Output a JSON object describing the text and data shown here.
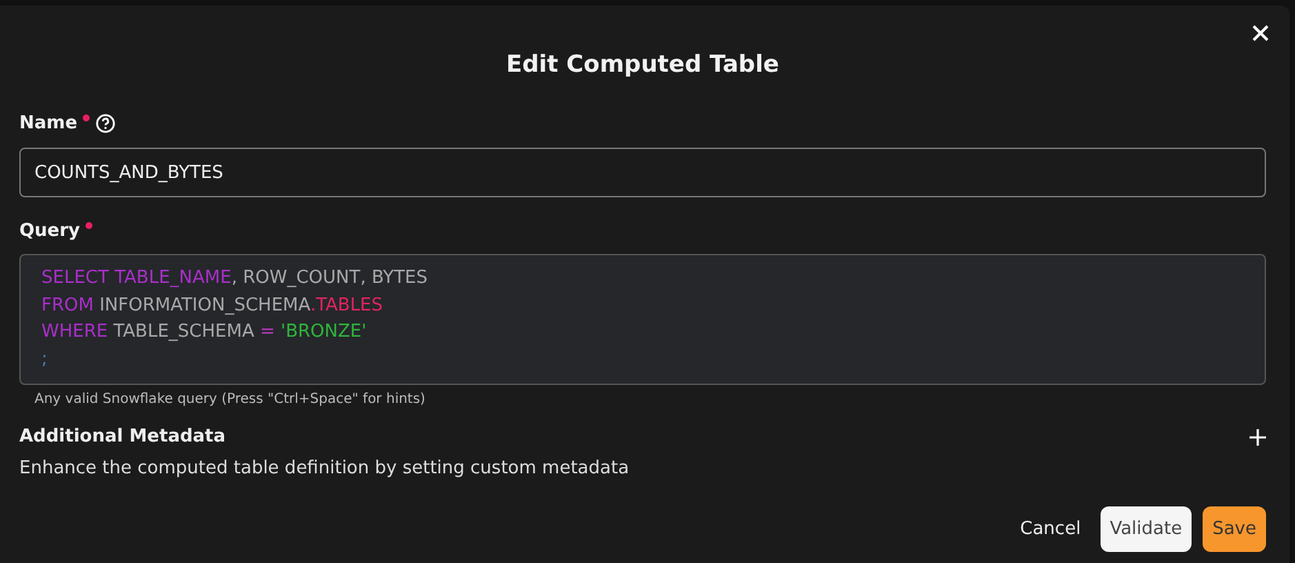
{
  "dialog": {
    "title": "Edit Computed Table"
  },
  "name_field": {
    "label": "Name",
    "required": true,
    "value": "COUNTS_AND_BYTES"
  },
  "query_field": {
    "label": "Query",
    "required": true,
    "hint": "Any valid Snowflake query (Press \"Ctrl+Space\" for hints)",
    "lines": [
      [
        {
          "kind": "keyword",
          "text": "SELECT "
        },
        {
          "kind": "keyword",
          "text": "TABLE_NAME"
        },
        {
          "kind": "plain",
          "text": ", ROW_COUNT, BYTES"
        }
      ],
      [
        {
          "kind": "keyword",
          "text": "FROM "
        },
        {
          "kind": "plain",
          "text": "INFORMATION_SCHEMA"
        },
        {
          "kind": "table",
          "text": ".TABLES"
        }
      ],
      [
        {
          "kind": "keyword",
          "text": "WHERE "
        },
        {
          "kind": "plain",
          "text": "TABLE_SCHEMA "
        },
        {
          "kind": "operator",
          "text": "= "
        },
        {
          "kind": "string",
          "text": "'BRONZE'"
        }
      ],
      [
        {
          "kind": "punctuation",
          "text": ";"
        }
      ]
    ]
  },
  "metadata": {
    "title": "Additional Metadata",
    "description": "Enhance the computed table definition by setting custom metadata"
  },
  "buttons": [
    {
      "kind": "text",
      "label": "Cancel"
    },
    {
      "kind": "secondary",
      "label": "Validate"
    },
    {
      "kind": "primary",
      "label": "Save"
    }
  ]
}
